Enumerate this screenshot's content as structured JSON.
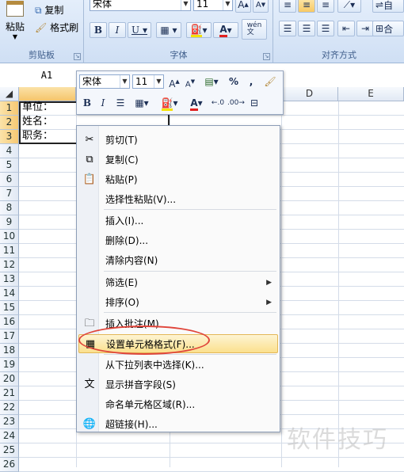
{
  "ribbon": {
    "clipboard": {
      "label": "剪贴板",
      "paste_label": "粘贴",
      "copy_label": "复制",
      "format_painter_label": "格式刷"
    },
    "font": {
      "label": "字体",
      "font_name": "宋体",
      "font_size": "11"
    },
    "alignment": {
      "label": "对齐方式",
      "wrap_label": "自",
      "merge_label": "合"
    }
  },
  "formula_bar": {
    "name_box": "A1"
  },
  "columns": [
    "D",
    "E"
  ],
  "rows": [
    "1",
    "2",
    "3",
    "4",
    "5",
    "6",
    "7",
    "8",
    "9",
    "10",
    "11",
    "12",
    "13",
    "14",
    "15",
    "16",
    "17",
    "18",
    "19",
    "20",
    "21",
    "22",
    "23",
    "24",
    "25",
    "26"
  ],
  "cells": {
    "A1": "单位：",
    "A2": "姓名：",
    "A3": "职务："
  },
  "mini_toolbar": {
    "font_name": "宋体",
    "font_size": "11"
  },
  "context_menu": {
    "items": [
      {
        "label": "剪切(T)",
        "icon": "scissors-icon"
      },
      {
        "label": "复制(C)",
        "icon": "copy-icon"
      },
      {
        "label": "粘贴(P)",
        "icon": "paste-icon"
      },
      {
        "label": "选择性粘贴(V)..."
      },
      {
        "label": "插入(I)..."
      },
      {
        "label": "删除(D)..."
      },
      {
        "label": "清除内容(N)"
      },
      {
        "label": "筛选(E)",
        "submenu": true
      },
      {
        "label": "排序(O)",
        "submenu": true
      },
      {
        "label": "插入批注(M)",
        "icon": "comment-icon"
      },
      {
        "label": "设置单元格格式(F)...",
        "icon": "format-cells-icon",
        "highlighted": true
      },
      {
        "label": "从下拉列表中选择(K)..."
      },
      {
        "label": "显示拼音字段(S)",
        "icon": "phonetic-icon"
      },
      {
        "label": "命名单元格区域(R)..."
      },
      {
        "label": "超链接(H)...",
        "icon": "hyperlink-icon"
      }
    ]
  },
  "watermark": "软件技巧",
  "colors": {
    "highlight": "#fbe08d",
    "annotation_circle": "#e0453a"
  }
}
